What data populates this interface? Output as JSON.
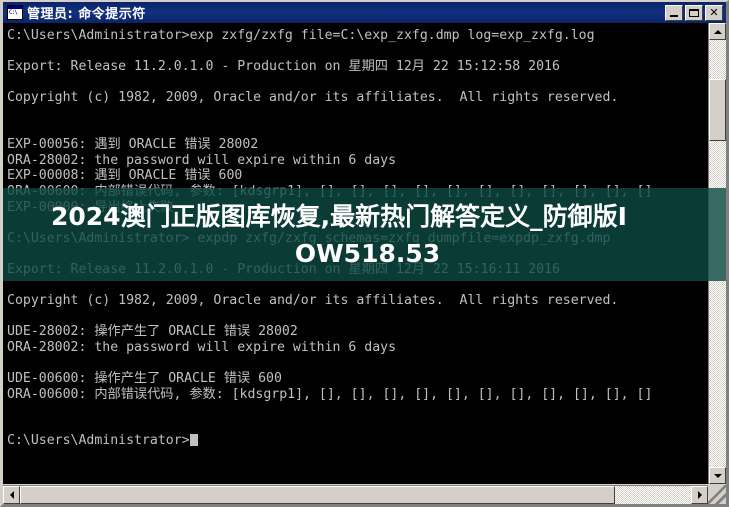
{
  "window": {
    "title": "管理员: 命令提示符",
    "icon": "cmd-icon",
    "icon_glyph": "C:\\",
    "colors": {
      "titlebar": "#0a246a",
      "frame": "#d4d0c8",
      "console_bg": "#000000",
      "console_fg": "#c0c0c0",
      "overlay": "#0e4a42"
    },
    "buttons": {
      "minimize": "_",
      "maximize": "□",
      "close": "✕"
    }
  },
  "terminal": {
    "lines": [
      "C:\\Users\\Administrator>exp zxfg/zxfg file=C:\\exp_zxfg.dmp log=exp_zxfg.log",
      "",
      "Export: Release 11.2.0.1.0 - Production on 星期四 12月 22 15:12:58 2016",
      "",
      "Copyright (c) 1982, 2009, Oracle and/or its affiliates.  All rights reserved.",
      "",
      "",
      "EXP-00056: 遇到 ORACLE 错误 28002",
      "ORA-28002: the password will expire within 6 days",
      "EXP-00008: 遇到 ORACLE 错误 600",
      "ORA-00600: 内部错误代码, 参数: [kdsgrp1], [], [], [], [], [], [], [], [], [], [], []",
      "EXP-00000: 导出终止失败",
      "",
      "C:\\Users\\Administrator> expdp zxfg/zxfg schemas=zxfg dumpfile=expdp_zxfg.dmp",
      "",
      "Export: Release 11.2.0.1.0 - Production on 星期四 12月 22 15:16:11 2016",
      "",
      "Copyright (c) 1982, 2009, Oracle and/or its affiliates.  All rights reserved.",
      "",
      "UDE-28002: 操作产生了 ORACLE 错误 28002",
      "ORA-28002: the password will expire within 6 days",
      "",
      "UDE-00600: 操作产生了 ORACLE 错误 600",
      "ORA-00600: 内部错误代码, 参数: [kdsgrp1], [], [], [], [], [], [], [], [], [], [], []",
      "",
      ""
    ],
    "prompt": "C:\\Users\\Administrator>",
    "cursor": "block"
  },
  "overlay": {
    "line1": "2024澳门正版图库恢复,最新热门解答定义_防御版I",
    "line2": "OW518.53"
  },
  "scrollbars": {
    "vertical": {
      "up_arrow": "▲",
      "down_arrow": "▼",
      "thumb_position": "near-top"
    },
    "horizontal": {
      "left_arrow": "◀",
      "right_arrow": "▶",
      "thumb_position": "left"
    }
  }
}
